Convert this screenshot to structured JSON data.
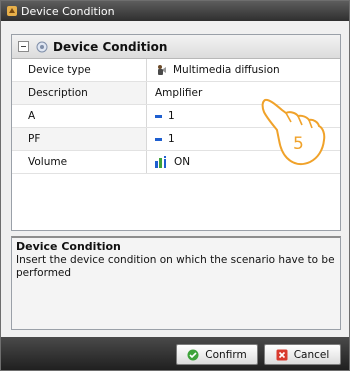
{
  "window": {
    "title": "Device Condition"
  },
  "section": {
    "title": "Device Condition"
  },
  "properties": [
    {
      "label": "Device type",
      "value": "Multimedia diffusion",
      "icon": "speaker-person-icon"
    },
    {
      "label": "Description",
      "value": "Amplifier",
      "icon": ""
    },
    {
      "label": "A",
      "value": "1",
      "icon": "blue-dash-icon"
    },
    {
      "label": "PF",
      "value": "1",
      "icon": "blue-dash-icon"
    },
    {
      "label": "Volume",
      "value": "ON",
      "icon": "info-bars-icon"
    }
  ],
  "description": {
    "title": "Device Condition",
    "text": "Insert the device condition on which the scenario have to be performed"
  },
  "buttons": {
    "confirm": "Confirm",
    "cancel": "Cancel"
  },
  "annotation": {
    "step": "5"
  },
  "colors": {
    "titlebar": "#3f3f3f",
    "accent": "#1e5fd0",
    "confirm_icon": "#3ea33a",
    "cancel_icon": "#d83a2e",
    "hand_outline": "#f0a22a"
  }
}
